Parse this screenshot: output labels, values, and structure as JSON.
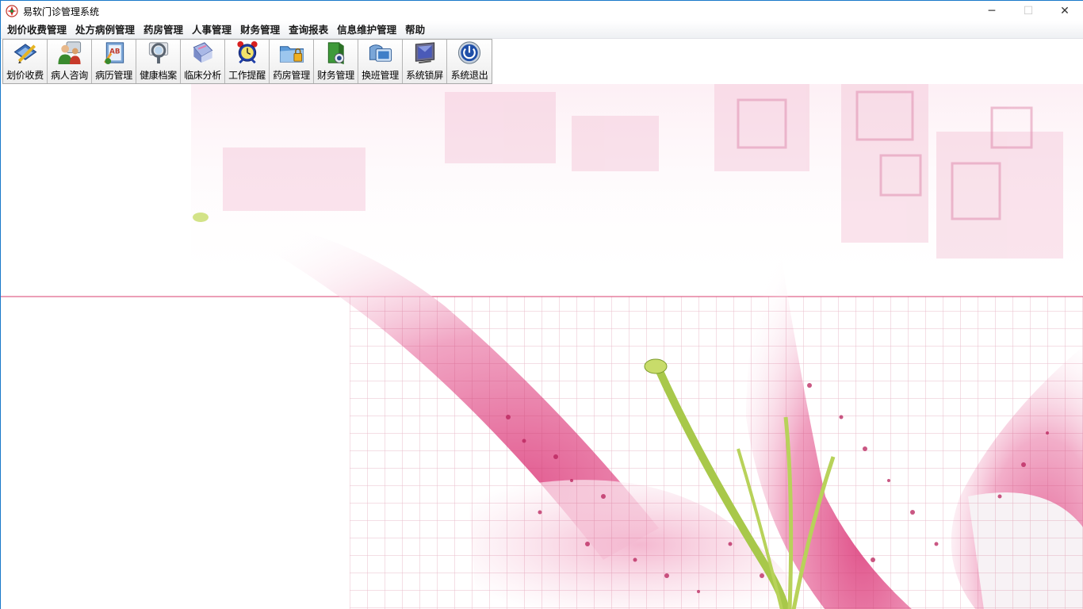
{
  "window": {
    "title": "易软门诊管理系统",
    "app_icon": "app-logo-icon",
    "controls": {
      "minimize": "─",
      "maximize": "☐",
      "close": "✕"
    }
  },
  "menu": {
    "items": [
      {
        "label": "划价收费管理"
      },
      {
        "label": "处方病例管理"
      },
      {
        "label": "药房管理"
      },
      {
        "label": "人事管理"
      },
      {
        "label": "财务管理"
      },
      {
        "label": "查询报表"
      },
      {
        "label": "信息维护管理"
      },
      {
        "label": "帮助"
      }
    ]
  },
  "toolbar": {
    "buttons": [
      {
        "label": "划价收费",
        "icon": "pricing-icon"
      },
      {
        "label": "病人咨询",
        "icon": "patient-consult-icon"
      },
      {
        "label": "病历管理",
        "icon": "medical-record-icon"
      },
      {
        "label": "健康档案",
        "icon": "health-file-icon"
      },
      {
        "label": "临床分析",
        "icon": "clinical-analysis-icon"
      },
      {
        "label": "工作提醒",
        "icon": "alarm-clock-icon"
      },
      {
        "label": "药房管理",
        "icon": "pharmacy-folder-icon"
      },
      {
        "label": "财务管理",
        "icon": "finance-icon"
      },
      {
        "label": "换班管理",
        "icon": "shift-change-icon"
      },
      {
        "label": "系统锁屏",
        "icon": "lock-screen-icon"
      },
      {
        "label": "系统退出",
        "icon": "power-icon"
      }
    ]
  },
  "colors": {
    "window_border": "#1979ca",
    "accent_pink": "#e0679a",
    "stamen_green": "#a8c84a"
  }
}
